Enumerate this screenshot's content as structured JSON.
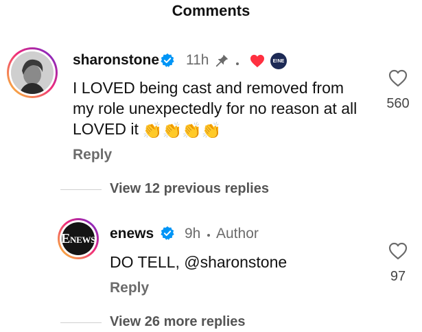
{
  "header": {
    "title": "Comments"
  },
  "comments": [
    {
      "username": "sharonstone",
      "time": "11h",
      "text": "I LOVED being cast and removed from my role unexpectedly for no reason at all LOVED it",
      "reaction_emoji": "👏👏👏👏",
      "reply_label": "Reply",
      "likes": "560",
      "view_replies": "View 12 previous replies",
      "badge_text": "E!NE"
    },
    {
      "username": "enews",
      "time": "9h",
      "author_label": "Author",
      "text": "DO TELL, @sharonstone",
      "reply_label": "Reply",
      "likes": "97",
      "view_replies": "View 26 more replies",
      "avatar_logo": "NEWS",
      "avatar_logo_prefix": "E"
    }
  ],
  "colors": {
    "verified": "#0095f6",
    "heart_red": "#ff3040",
    "text_muted": "#6b6b6b"
  },
  "icons": [
    "verified-icon",
    "pin-icon",
    "heart-icon",
    "like-heart-icon"
  ]
}
